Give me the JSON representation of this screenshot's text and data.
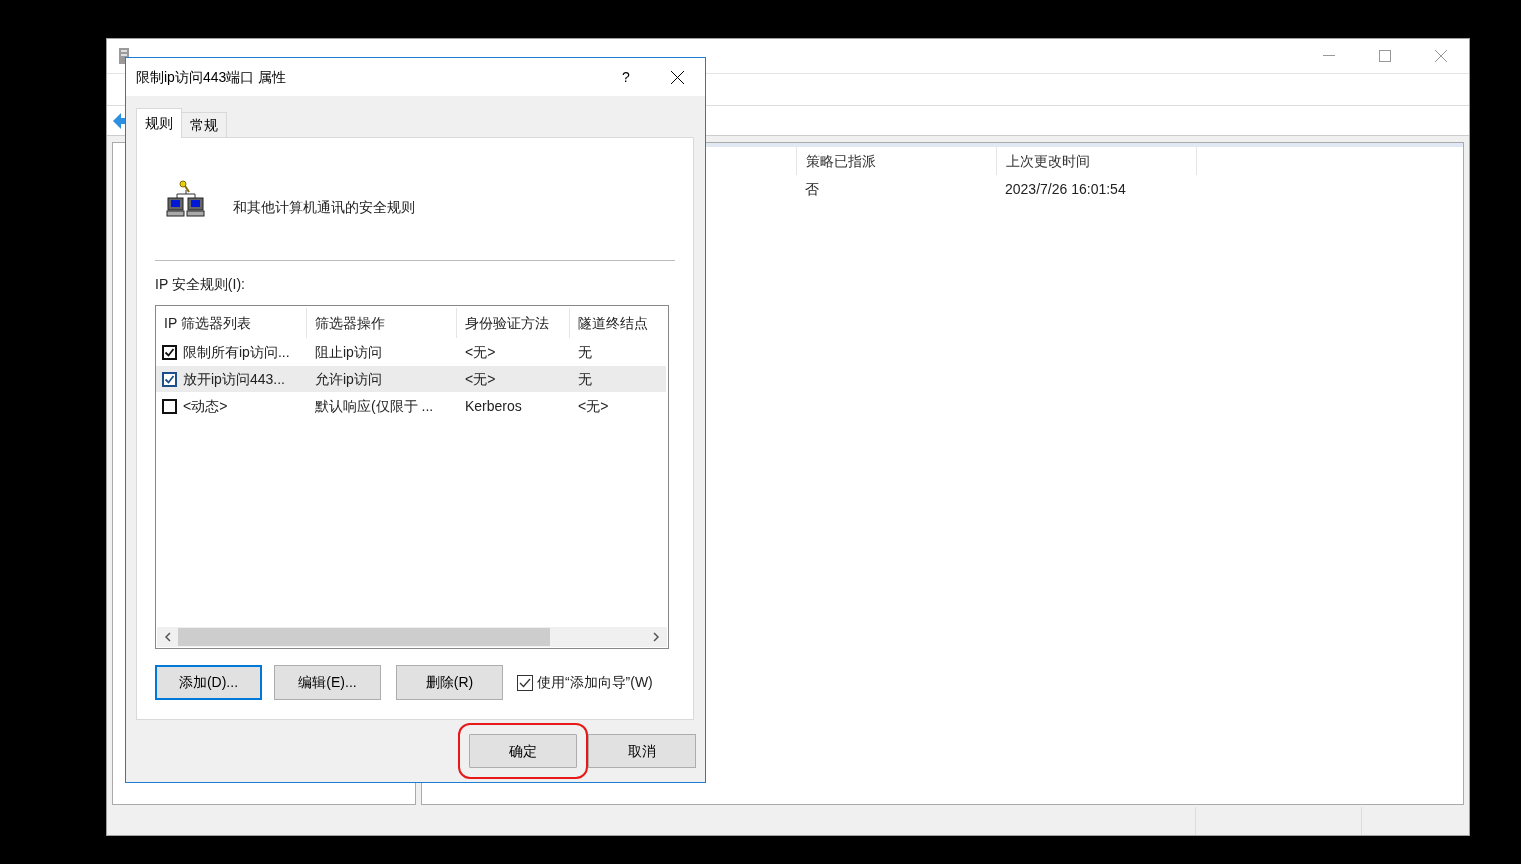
{
  "background_window": {
    "columns": [
      {
        "label": "策略已指派"
      },
      {
        "label": "上次更改时间"
      }
    ],
    "rows": [
      {
        "cells": [
          "否",
          "2023/7/26 16:01:54"
        ]
      }
    ]
  },
  "dialog": {
    "title": "限制ip访问443端口 属性",
    "help": "?",
    "tabs": [
      {
        "label": "规则",
        "selected": true
      },
      {
        "label": "常规",
        "selected": false
      }
    ],
    "description": "和其他计算机通讯的安全规则",
    "list_label": "IP 安全规则(I):",
    "columns": [
      "IP 筛选器列表",
      "筛选器操作",
      "身份验证方法",
      "隧道终结点"
    ],
    "rules": [
      {
        "checked": true,
        "selected": false,
        "cells": [
          "限制所有ip访问...",
          "阻止ip访问",
          "<无>",
          "无"
        ]
      },
      {
        "checked": true,
        "selected": true,
        "cells": [
          "放开ip访问443...",
          "允许ip访问",
          "<无>",
          "无"
        ]
      },
      {
        "checked": false,
        "selected": false,
        "cells": [
          "<动态>",
          "默认响应(仅限于 ...",
          "Kerberos",
          "<无>"
        ]
      }
    ],
    "buttons": [
      {
        "label": "添加(D)...",
        "focused": true
      },
      {
        "label": "编辑(E)...",
        "focused": false
      },
      {
        "label": "删除(R)",
        "focused": false
      }
    ],
    "wizard": {
      "label": "使用“添加向导”(W)",
      "checked": true
    },
    "footer_buttons": [
      {
        "label": "确定",
        "highlighted": true
      },
      {
        "label": "取消",
        "highlighted": false
      }
    ]
  }
}
